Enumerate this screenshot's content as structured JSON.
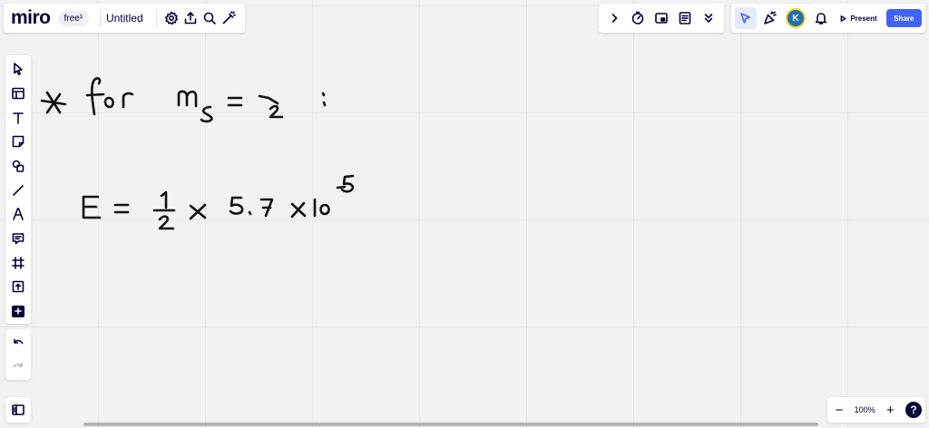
{
  "app": {
    "logo": "miro",
    "plan_badge": "free¹",
    "board_title": "Untitled"
  },
  "top_left_icons": [
    "settings-icon",
    "upload-icon",
    "search-icon",
    "magic-icon"
  ],
  "top_right_icons": [
    "chevron-right-icon",
    "timer-icon",
    "card-icon",
    "notes-icon",
    "chevrons-down-icon"
  ],
  "collab": {
    "avatar_initial": "K",
    "present_label": "Present",
    "share_label": "Share"
  },
  "toolbar_tools": [
    "select",
    "templates",
    "text",
    "sticky-note",
    "shapes",
    "pen",
    "draw",
    "comment",
    "frame",
    "upload",
    "more"
  ],
  "zoom": {
    "value": "100%",
    "minus": "−",
    "plus": "+",
    "help": "?"
  },
  "colors": {
    "accent": "#4262ff",
    "ink": "#050038",
    "avatar": "#1e73a8"
  },
  "whiteboard": {
    "line1": "∗ for m_s = 1/2 :",
    "line2": "E = 1/2 × 5.7 × 10^-5"
  }
}
